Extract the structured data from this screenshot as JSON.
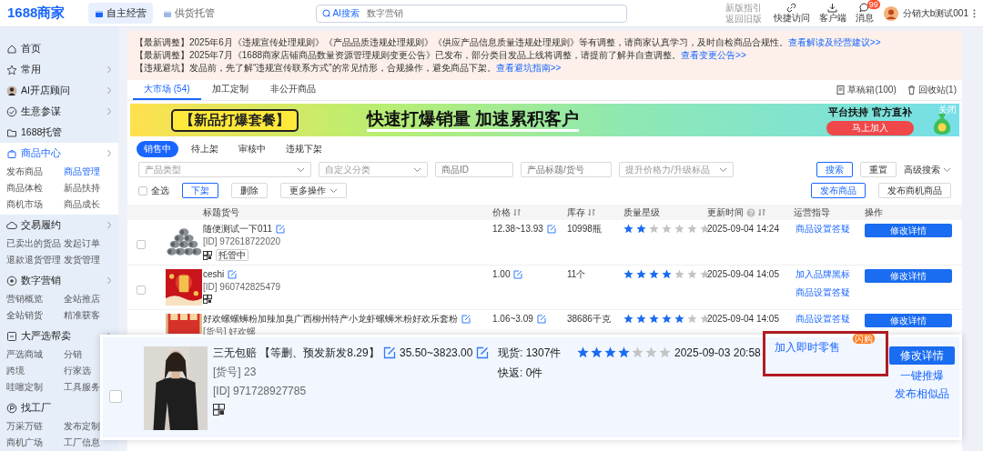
{
  "top_bar": {
    "logo_number": "1688",
    "logo_text": "商家",
    "tabs": [
      {
        "label": "自主经营",
        "selected": true
      },
      {
        "label": "供货托管",
        "selected": false
      }
    ],
    "search": {
      "badge": "AI搜索",
      "placeholder": "数字营销"
    },
    "guide_links": [
      "新版指引",
      "返回旧版"
    ],
    "shortcuts": [
      {
        "label": "快捷访问"
      },
      {
        "label": "客户端"
      },
      {
        "label": "消息",
        "badge": "99"
      }
    ],
    "user": "分销大b测试001"
  },
  "sidebar": {
    "items": [
      {
        "label": "首页",
        "expandable": false,
        "selected": false
      },
      {
        "label": "常用",
        "expandable": true,
        "selected": false
      },
      {
        "label": "AI开店顾问",
        "expandable": true,
        "selected": false
      },
      {
        "label": "生意参谋",
        "expandable": true,
        "selected": false
      },
      {
        "label": "1688托管",
        "expandable": false,
        "selected": false
      },
      {
        "label": "商品中心",
        "expandable": true,
        "selected": true,
        "children": [
          {
            "label": "发布商品",
            "selected": false
          },
          {
            "label": "商品管理",
            "selected": true
          },
          {
            "label": "商品体检",
            "selected": false
          },
          {
            "label": "新品扶持",
            "selected": false
          },
          {
            "label": "商机市场",
            "selected": false
          },
          {
            "label": "商品成长",
            "selected": false
          }
        ]
      },
      {
        "label": "交易履约",
        "expandable": true,
        "selected": false,
        "children": [
          {
            "label": "已卖出的货品",
            "selected": false
          },
          {
            "label": "发起订单",
            "selected": false
          },
          {
            "label": "退款退货管理",
            "selected": false
          },
          {
            "label": "发货管理",
            "selected": false
          }
        ]
      },
      {
        "label": "数字营销",
        "expandable": true,
        "selected": false,
        "children": [
          {
            "label": "营销概览",
            "selected": false
          },
          {
            "label": "全站推店",
            "selected": false
          },
          {
            "label": "全站销货",
            "selected": false
          },
          {
            "label": "精准获客",
            "selected": false
          }
        ]
      },
      {
        "label": "大严选帮卖",
        "expandable": true,
        "selected": false,
        "children": [
          {
            "label": "严选商城",
            "selected": false
          },
          {
            "label": "分销",
            "selected": false
          },
          {
            "label": "跨境",
            "selected": false
          },
          {
            "label": "行家选",
            "selected": false
          },
          {
            "label": "哇噻定制",
            "selected": false
          },
          {
            "label": "工具服务",
            "selected": false
          }
        ]
      },
      {
        "label": "找工厂",
        "expandable": false,
        "selected": false,
        "children": [
          {
            "label": "万采万链",
            "selected": false
          },
          {
            "label": "发布定制",
            "selected": false
          },
          {
            "label": "商机广场",
            "selected": false
          },
          {
            "label": "工厂信息",
            "selected": false
          }
        ]
      }
    ]
  },
  "notices": [
    {
      "text": "【最新调整】2025年6月《违规宣传处理规则》《产品品质违规处理规则》《供应产品信息质量违规处理规则》等有调整，请商家认真学习，及时自检商品合规性。",
      "link": "查看解读及经营建议>>"
    },
    {
      "text": "【最新调整】2025年7月《1688商家店铺商品数量资源管理规则变更公告》已发布，部分类目发品上线将调整，请提前了解并自查调整。",
      "link": "查看变更公告>>"
    },
    {
      "text": "【违规避坑】发品前，先了解“违规宣传联系方式”的常见情形，合规操作，避免商品下架。",
      "link": "查看避坑指南>>"
    }
  ],
  "tabs": [
    {
      "label": "大市场",
      "count": "(54)",
      "selected": true
    },
    {
      "label": "加工定制",
      "selected": false
    },
    {
      "label": "非公开商品",
      "selected": false
    }
  ],
  "tab_tools": [
    "草稿箱(100)",
    "回收站(1)"
  ],
  "banner": {
    "tag": "【新品打爆套餐】",
    "headline": "快速打爆销量 加速累积客户",
    "promo": "平台扶持 官方直补",
    "cta": "马上加入",
    "close": "关闭"
  },
  "status_filters": [
    {
      "label": "销售中",
      "selected": true
    },
    {
      "label": "待上架",
      "selected": false
    },
    {
      "label": "审核中",
      "selected": false
    },
    {
      "label": "违规下架",
      "selected": false
    }
  ],
  "filters": [
    {
      "kind": "select",
      "placeholder": "产品类型"
    },
    {
      "kind": "select",
      "placeholder": "自定义分类"
    },
    {
      "kind": "input",
      "placeholder": "商品ID"
    },
    {
      "kind": "input",
      "placeholder": "产品标题/货号"
    },
    {
      "kind": "select",
      "placeholder": "提升价格力/升级标品"
    }
  ],
  "filter_buttons": [
    "搜索",
    "重置"
  ],
  "advanced_search": "高级搜索",
  "bulk": {
    "select_all": {
      "label": "全选",
      "checked": false
    },
    "buttons": [
      "下架",
      "删除"
    ],
    "more": "更多操作"
  },
  "publish_buttons": [
    "发布商品",
    "发布商机商品"
  ],
  "table": {
    "columns": [
      {
        "label": "标题货号",
        "sortable": false,
        "help": false
      },
      {
        "label": "价格",
        "sortable": true,
        "help": false
      },
      {
        "label": "库存",
        "sortable": true,
        "help": false
      },
      {
        "label": "质量星级",
        "sortable": false,
        "help": false
      },
      {
        "label": "更新时间",
        "sortable": true,
        "help": true
      },
      {
        "label": "运营指导",
        "sortable": false,
        "help": false
      },
      {
        "label": "操作",
        "sortable": false,
        "help": false
      }
    ],
    "rows": [
      {
        "checked": false,
        "title": "随便测试一下011",
        "id": "[ID] 972618722020",
        "tag": "托管中",
        "price": "12.38~13.93",
        "stock": [
          "10998瓶"
        ],
        "stars": 2,
        "updated": "2025-09-04 14:24",
        "guides": [
          {
            "label": "商品设置答疑"
          }
        ],
        "action": "修改详情"
      },
      {
        "checked": false,
        "title": "ceshi",
        "id": "[ID] 960742825479",
        "price": "1.00",
        "stock": [
          "11个"
        ],
        "stars": 4,
        "updated": "2025-09-04 14:05",
        "guides": [
          {
            "label": "加入品牌黑标"
          },
          {
            "label": "商品设置答疑"
          }
        ],
        "action": "修改详情"
      },
      {
        "title": "好欢螺螺蛳粉加辣加臭广西柳州特产小龙虾螺蛳米粉好欢乐套粉",
        "sku": "[货号] 好欢螺",
        "price": "1.06~3.09",
        "stock": [
          "38686千克"
        ],
        "stars": 5,
        "updated": "2025-09-04 14:05",
        "guides": [
          {
            "label": "商品设置答疑"
          }
        ],
        "action": "修改详情"
      }
    ]
  },
  "callout": {
    "checked": false,
    "title": "三无包赔 【等删、预发新发8.29】",
    "sku": "[货号] 23",
    "id": "[ID] 971728927785",
    "price": "35.50~3823.00",
    "stock": [
      "现货: 1307件",
      "快返: 0件"
    ],
    "stars": 4,
    "updated": "2025-09-03 20:58",
    "guides": [
      {
        "label": "加入即时零售",
        "badge": "闪购",
        "highlighted": true
      }
    ],
    "action": "修改详情",
    "links": [
      "一键推爆",
      "发布相似品"
    ]
  }
}
